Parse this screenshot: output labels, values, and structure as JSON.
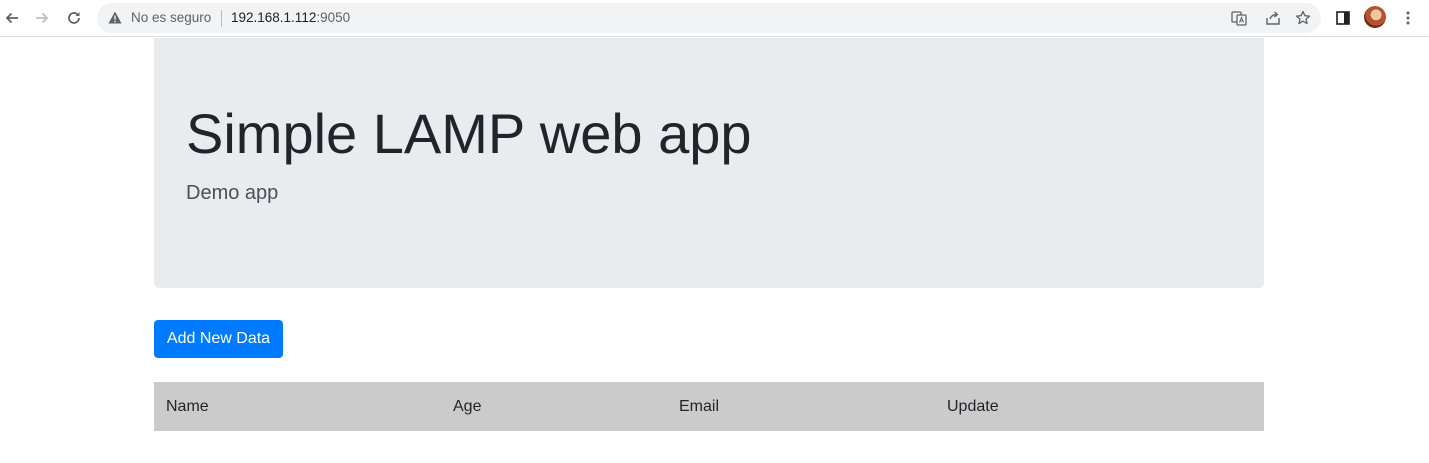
{
  "browser": {
    "security_label": "No es seguro",
    "url_host": "192.168.1.112",
    "url_port": ":9050",
    "icons": [
      "back-icon",
      "forward-icon",
      "reload-icon",
      "warning-icon",
      "translate-icon",
      "share-icon",
      "bookmark-star-icon",
      "side-panel-icon",
      "profile-avatar",
      "menu-kebab-icon"
    ]
  },
  "jumbotron": {
    "title": "Simple LAMP web app",
    "subtitle": "Demo app"
  },
  "actions": {
    "add_label": "Add New Data"
  },
  "table": {
    "columns": [
      "Name",
      "Age",
      "Email",
      "Update"
    ]
  },
  "colors": {
    "primary": "#007bff",
    "jumbotron_bg": "#e9ecef",
    "table_header_bg": "#cbcbcb"
  }
}
